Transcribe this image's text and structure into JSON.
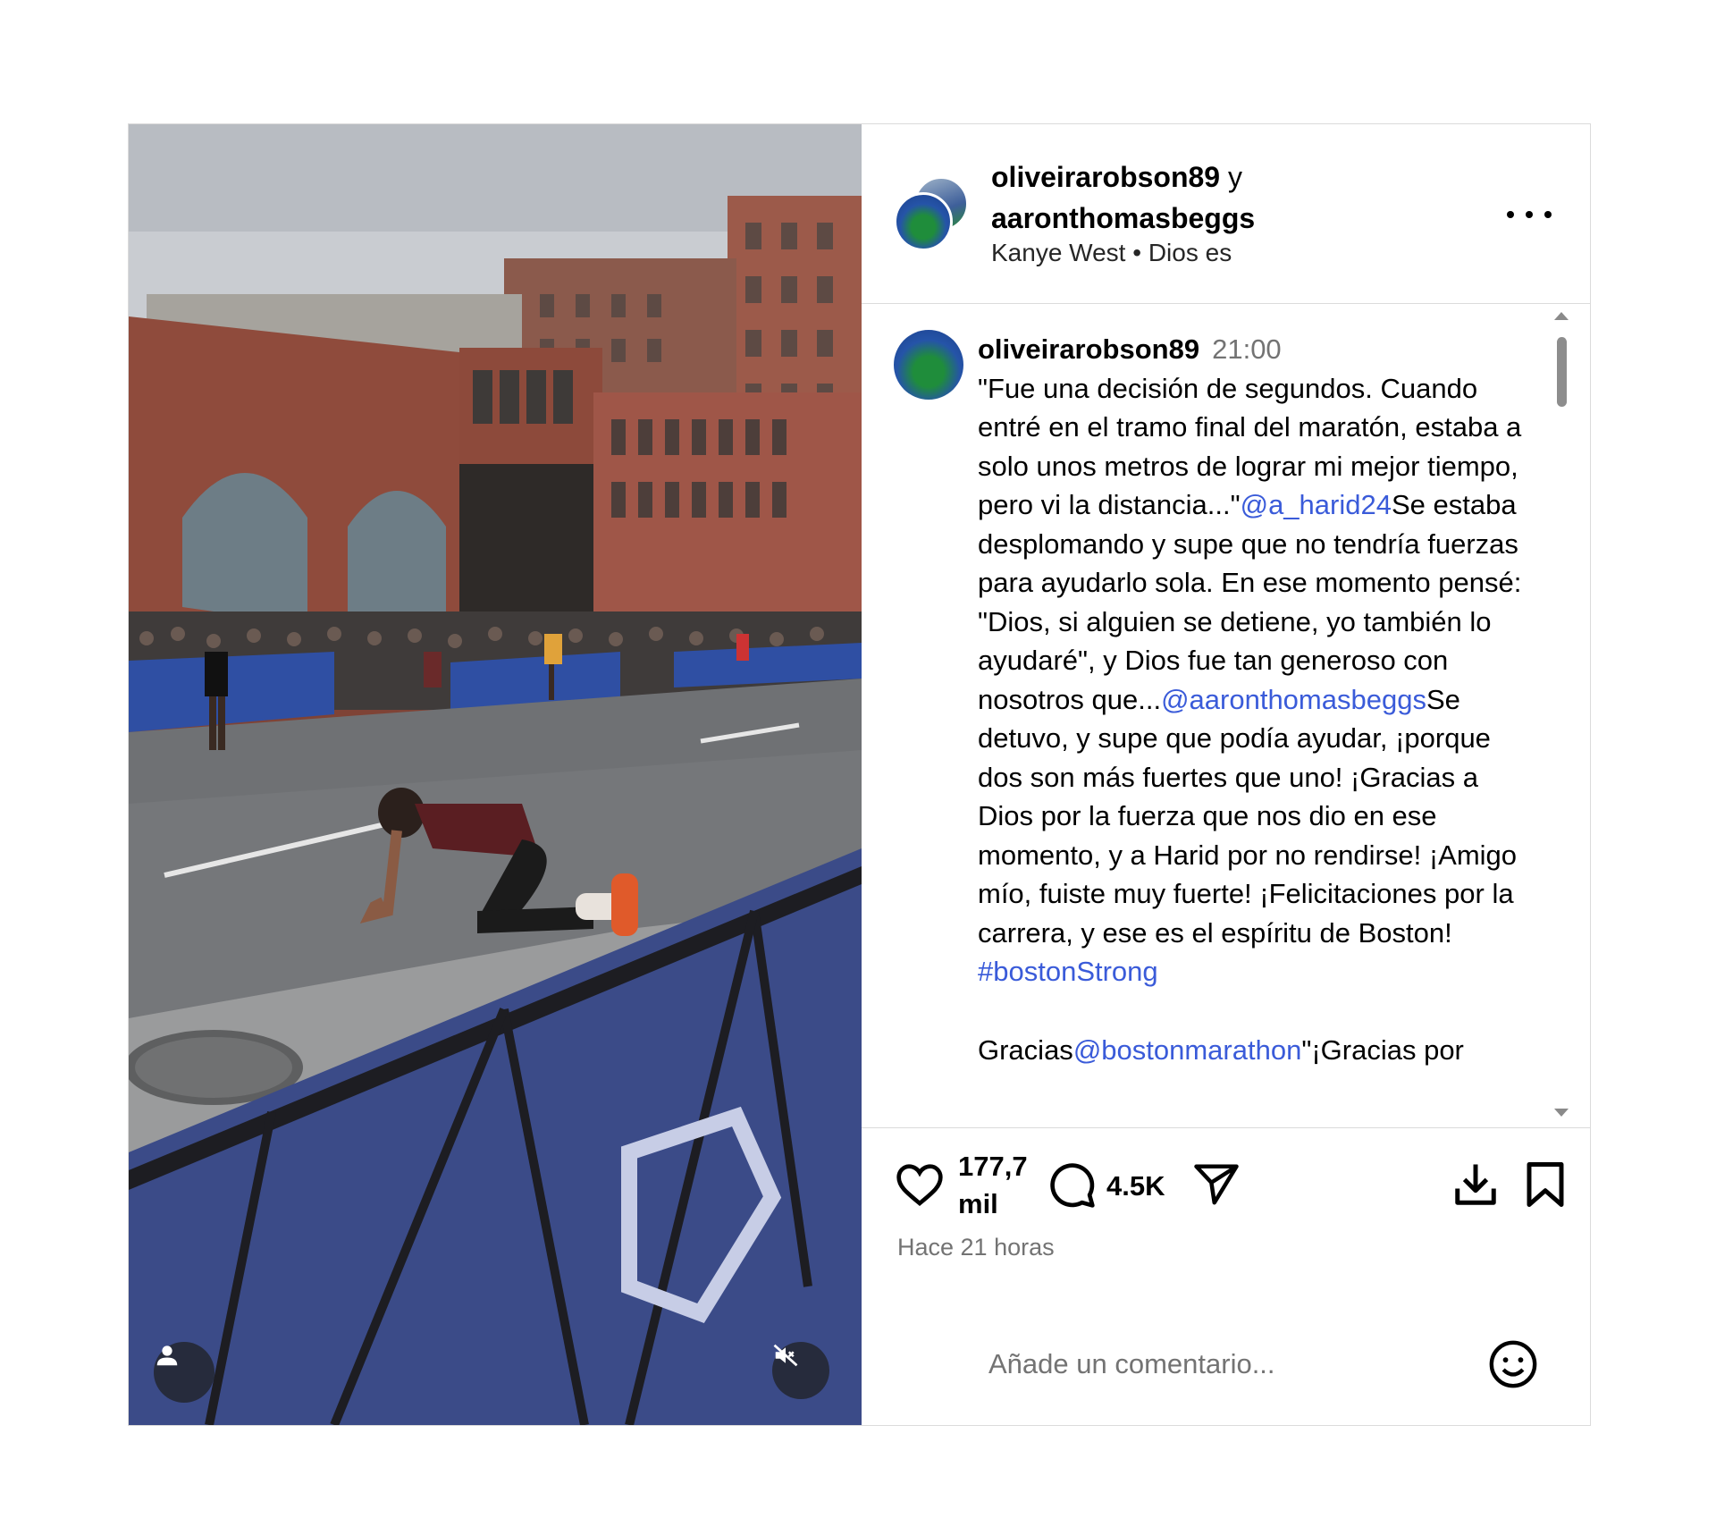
{
  "header": {
    "user1": "oliveirarobson89",
    "connector": "y",
    "user2": "aaronthomasbeggs",
    "audio_artist": "Kanye West",
    "separator": "•",
    "audio_title": "Dios es"
  },
  "caption": {
    "username": "oliveirarobson89",
    "time": "21:00",
    "t1": "\"Fue una decisión de segundos. Cuando entré en el tramo final del maratón, estaba a solo unos metros de lograr mi mejor tiempo, pero vi la distancia...\"",
    "m1": "@a_harid24",
    "t2": "Se estaba desplomando y supe que no tendría fuerzas para ayudarlo sola. En ese momento pensé: \"Dios, si alguien se detiene, yo también lo ayudaré\", y Dios fue tan generoso con nosotros que...",
    "m2": "@aaronthomasbeggs",
    "t3": "Se detuvo, y supe que podía ayudar, ¡porque dos son más fuertes que uno! ¡Gracias a Dios por la fuerza que nos dio en ese momento, y a Harid por no rendirse! ¡Amigo mío, fuiste muy fuerte! ¡Felicitaciones por la carrera, y ese es el espíritu de Boston!",
    "hashtag": "#bostonStrong",
    "p2_prefix": "Gracias",
    "p2_mention": "@bostonmarathon",
    "p2_suffix": "\"¡Gracias por"
  },
  "actions": {
    "likes_line1": "177,7",
    "likes_line2": "mil",
    "comments": "4.5K",
    "time_ago": "Hace 21 horas"
  },
  "comment_box": {
    "placeholder": "Añade un comentario..."
  },
  "icons": {
    "like": "heart-icon",
    "comment": "comment-bubble-icon",
    "share": "paper-plane-icon",
    "download": "download-icon",
    "save": "bookmark-icon",
    "more": "more-options-icon",
    "emoji": "emoji-icon",
    "user_tags": "user-icon",
    "mute": "speaker-muted-icon"
  },
  "colors": {
    "link": "#3a5bd9",
    "secondary_text": "#737373",
    "border": "#dbdbdb"
  }
}
